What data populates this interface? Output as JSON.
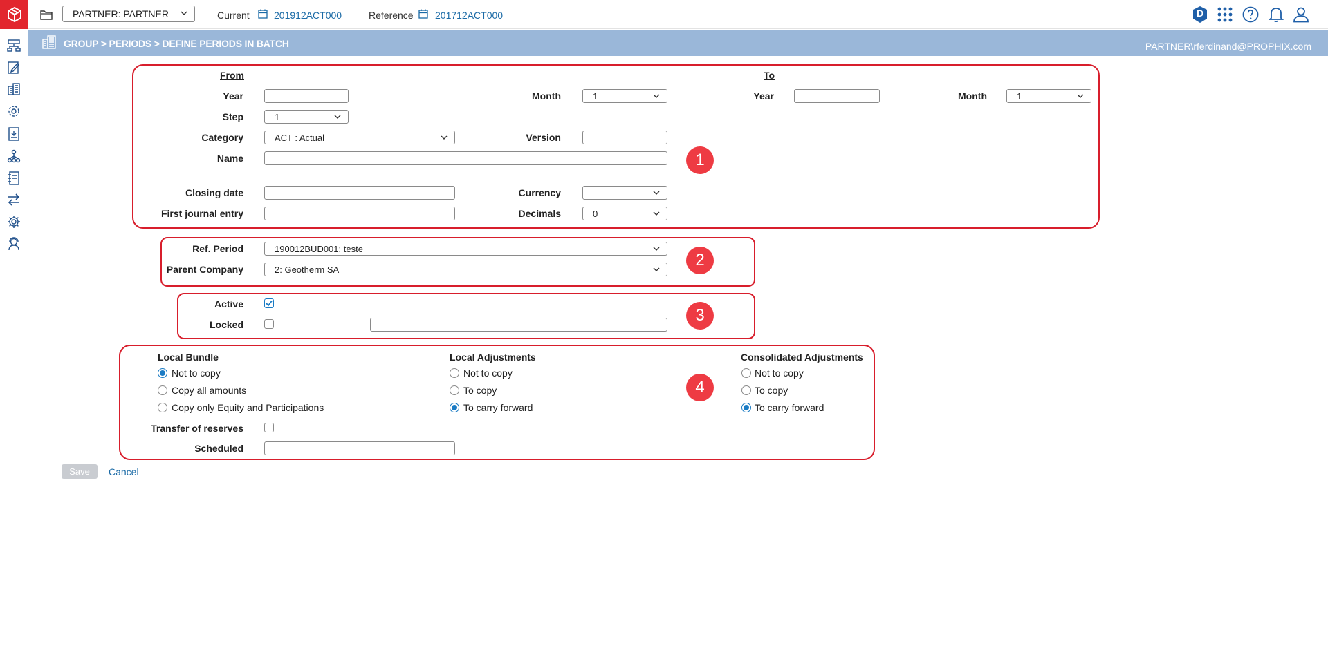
{
  "topbar": {
    "partner_selector": "PARTNER: PARTNER",
    "current_label": "Current",
    "current_value": "201912ACT000",
    "reference_label": "Reference",
    "reference_value": "201712ACT000",
    "badge_letter": "D"
  },
  "header": {
    "breadcrumb": "GROUP > PERIODS > DEFINE PERIODS IN BATCH",
    "user": "PARTNER\\rferdinand@PROPHIX.com"
  },
  "section1": {
    "from_label": "From",
    "to_label": "To",
    "year_label": "Year",
    "month_label": "Month",
    "from_year": "",
    "from_month": "1",
    "to_year": "",
    "to_month": "1",
    "step_label": "Step",
    "step_value": "1",
    "category_label": "Category",
    "category_value": "ACT : Actual",
    "version_label": "Version",
    "version_value": "",
    "name_label": "Name",
    "name_value": "",
    "closing_date_label": "Closing date",
    "closing_date_value": "",
    "currency_label": "Currency",
    "currency_value": "",
    "first_journal_label": "First journal entry",
    "first_journal_value": "",
    "decimals_label": "Decimals",
    "decimals_value": "0",
    "badge": "1"
  },
  "section2": {
    "ref_period_label": "Ref. Period",
    "ref_period_value": "190012BUD001: teste",
    "parent_company_label": "Parent Company",
    "parent_company_value": "2: Geotherm SA",
    "badge": "2"
  },
  "section3": {
    "active_label": "Active",
    "active_checked": true,
    "locked_label": "Locked",
    "locked_checked": false,
    "locked_text": "",
    "badge": "3"
  },
  "section4": {
    "local_bundle": {
      "title": "Local Bundle",
      "options": [
        "Not to copy",
        "Copy all amounts",
        "Copy only Equity and Participations"
      ],
      "selected": "Not to copy"
    },
    "local_adjustments": {
      "title": "Local Adjustments",
      "options": [
        "Not to copy",
        "To copy",
        "To carry forward"
      ],
      "selected": "To carry forward"
    },
    "consolidated_adjustments": {
      "title": "Consolidated Adjustments",
      "options": [
        "Not to copy",
        "To copy",
        "To carry forward"
      ],
      "selected": "To carry forward"
    },
    "transfer_reserves_label": "Transfer of reserves",
    "transfer_reserves_checked": false,
    "scheduled_label": "Scheduled",
    "scheduled_value": "",
    "badge": "4"
  },
  "actions": {
    "save_label": "Save",
    "cancel_label": "Cancel"
  },
  "colors": {
    "brand_red": "#e2262e",
    "header_band": "#9ab7d9",
    "link_blue": "#1a6aa6",
    "annotation_red": "#d81e2c"
  }
}
